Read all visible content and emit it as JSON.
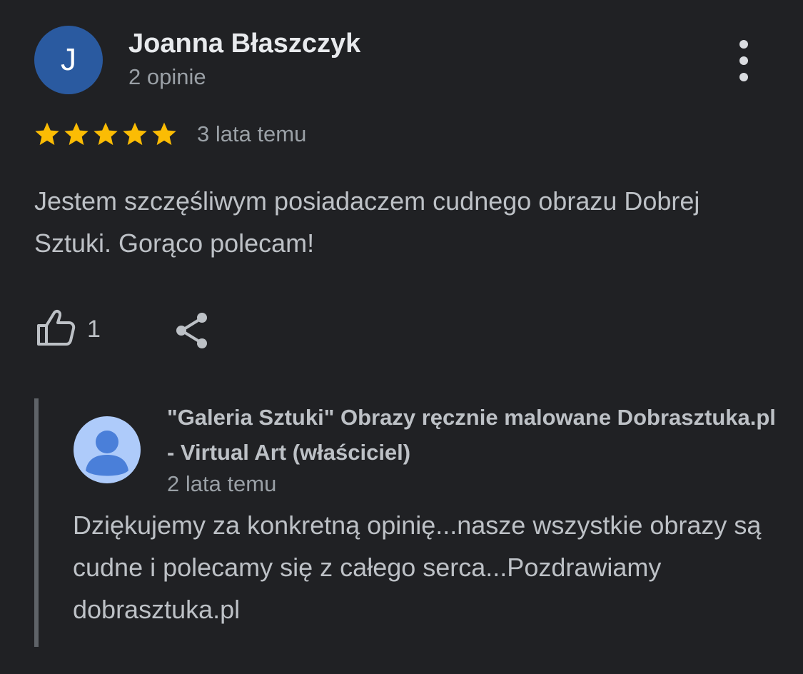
{
  "review": {
    "author": {
      "initial": "J",
      "name": "Joanna Błaszczyk",
      "meta": "2 opinie",
      "avatar_color": "#2a5aa0"
    },
    "rating": 5,
    "date": "3 lata temu",
    "text": "Jestem szczęśliwym posiadaczem cudnego obrazu Dobrej Sztuki. Gorąco polecam!",
    "likes": "1",
    "icons": {
      "more": "more-vert-icon",
      "like": "thumb-up-icon",
      "share": "share-icon",
      "star": "star-icon"
    },
    "star_color": "#fbbc04"
  },
  "owner_reply": {
    "name": "\"Galeria Sztuki\" Obrazy ręcznie malowane Dobrasztuka.pl - Virtual Art (właściciel)",
    "date": "2 lata temu",
    "text": "Dziękujemy za konkretną opinię...nasze wszystkie obrazy są cudne i polecamy się z całego serca...Pozdrawiamy dobrasztuka.pl",
    "avatar_color": "#aecbfa",
    "avatar_icon": "person-icon"
  },
  "theme": {
    "background": "#202124",
    "text_primary": "#e8eaed",
    "text_secondary": "#9aa0a6"
  }
}
